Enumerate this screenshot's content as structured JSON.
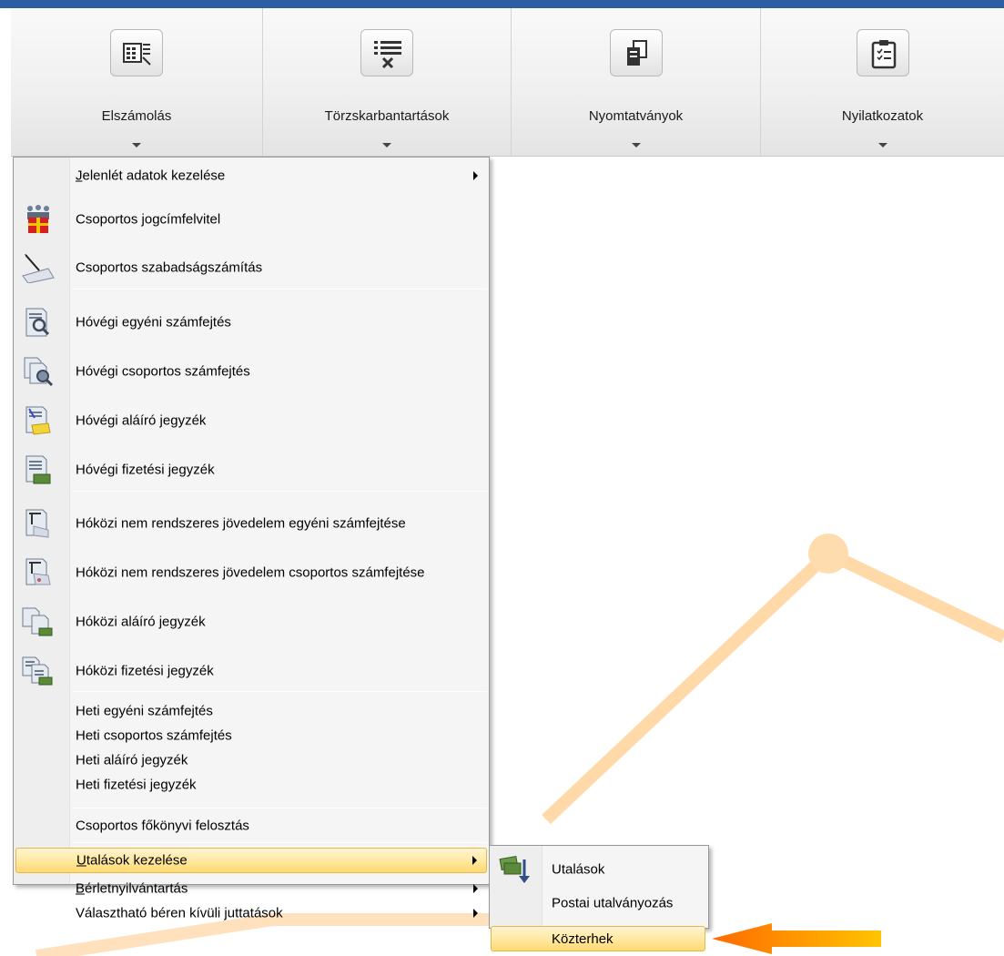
{
  "ribbon": {
    "groups": [
      {
        "label": "Elszámolás",
        "icon": "calculator-list-icon"
      },
      {
        "label": "Törzskarbantartások",
        "icon": "list-tools-icon"
      },
      {
        "label": "Nyomtatványok",
        "icon": "documents-icon"
      },
      {
        "label": "Nyilatkozatok",
        "icon": "clipboard-checklist-icon"
      }
    ]
  },
  "main_menu": {
    "items": [
      {
        "label": "Jelenlét adatok kezelése",
        "underline": "J",
        "has_submenu": true
      },
      {
        "label": "Csoportos jogcímfelvitel",
        "icon": "group-gift-icon"
      },
      {
        "label": "Csoportos szabadságszámítás",
        "icon": "calendar-pen-icon"
      },
      {
        "label": "Hóvégi egyéni számfejtés",
        "icon": "document-magnifier-icon"
      },
      {
        "label": "Hóvégi csoportos számfejtés",
        "icon": "document-group-magnifier-icon"
      },
      {
        "label": "Hóvégi aláíró jegyzék",
        "icon": "document-signature-icon"
      },
      {
        "label": "Hóvégi fizetési jegyzék",
        "icon": "document-money-icon"
      },
      {
        "label": "Hóközi nem rendszeres jövedelem egyéni számfejtése",
        "icon": "document-chart-icon"
      },
      {
        "label": "Hóközi nem rendszeres jövedelem csoportos számfejtése",
        "icon": "documents-chart-icon"
      },
      {
        "label": "Hóközi aláíró jegyzék",
        "icon": "documents-signature-icon"
      },
      {
        "label": "Hóközi fizetési jegyzék",
        "icon": "documents-money-icon"
      },
      {
        "label": "Heti egyéni számfejtés"
      },
      {
        "label": "Heti csoportos számfejtés"
      },
      {
        "label": "Heti aláíró jegyzék"
      },
      {
        "label": "Heti fizetési jegyzék"
      },
      {
        "label": "Csoportos főkönyvi felosztás"
      },
      {
        "label": "Utalások kezelése",
        "underline": "U",
        "has_submenu": true,
        "highlighted": true
      },
      {
        "label": "Bérletnyilvántartás",
        "underline": "B",
        "has_submenu": true
      },
      {
        "label": "Választható béren kívüli juttatások",
        "has_submenu": true
      }
    ]
  },
  "submenu": {
    "items": [
      {
        "label": "Utalások",
        "icon": "money-transfer-icon"
      },
      {
        "label": "Postai utalványozás"
      },
      {
        "label": "Közterhek",
        "highlighted": true
      }
    ]
  },
  "colors": {
    "accent_bar": "#2d5ea3",
    "highlight": "#ffe39a",
    "pointer_arrow": "#ff8c00",
    "bg_chart_line": "#ffc98a"
  }
}
